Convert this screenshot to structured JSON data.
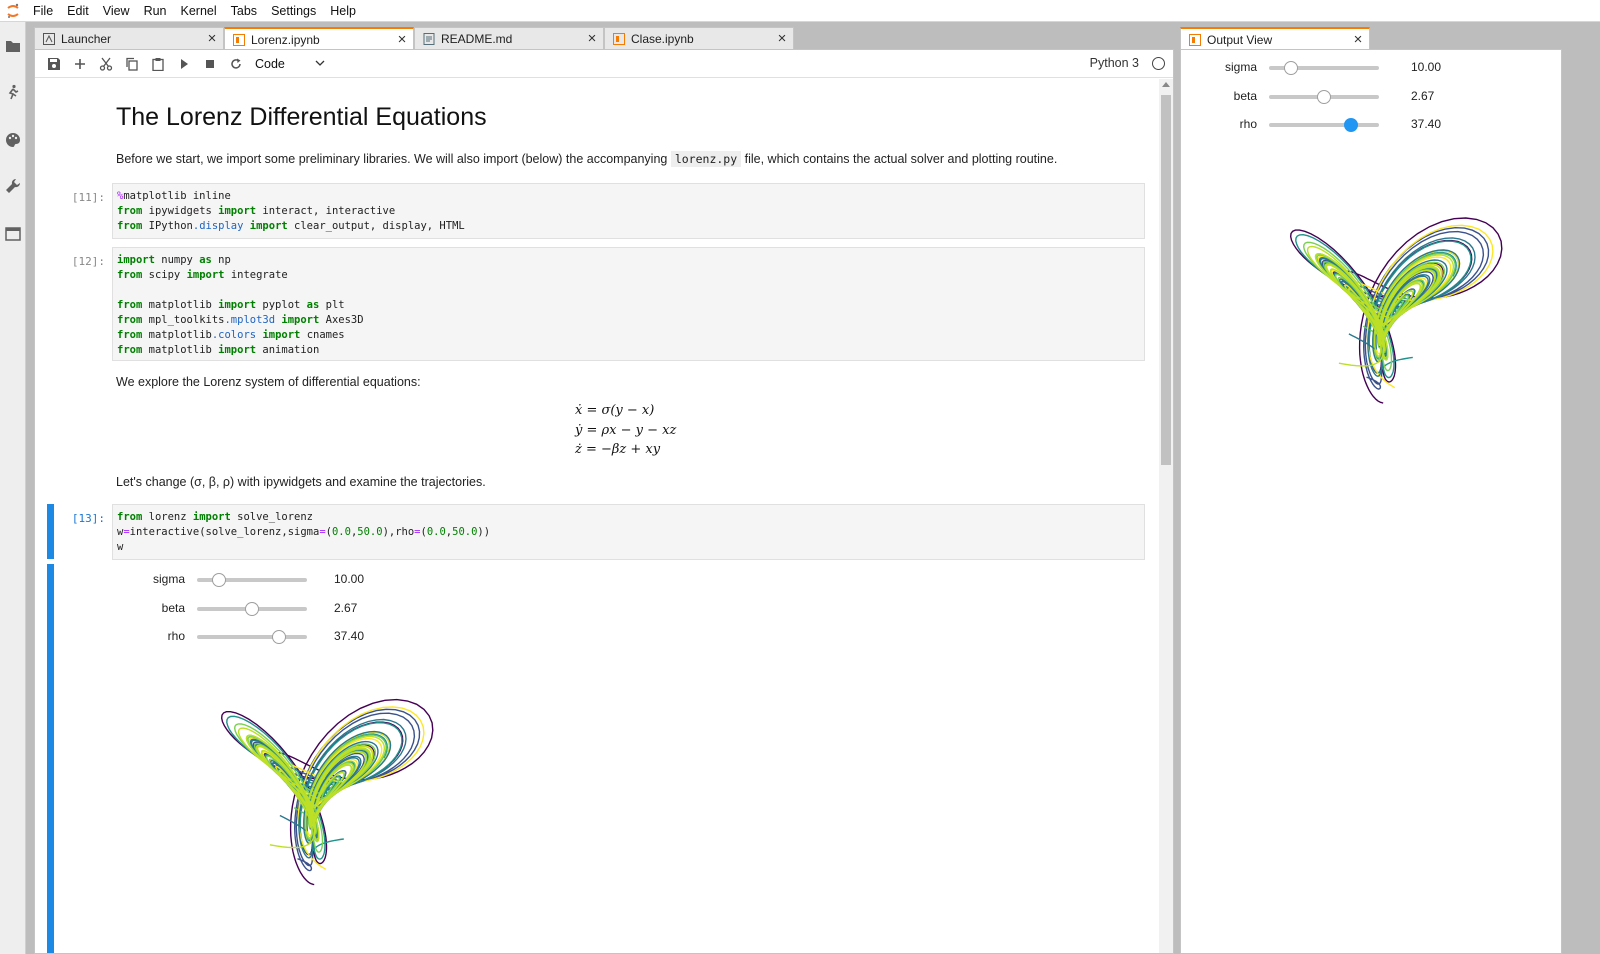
{
  "menu": [
    "File",
    "Edit",
    "View",
    "Run",
    "Kernel",
    "Tabs",
    "Settings",
    "Help"
  ],
  "tabs": [
    {
      "label": "Launcher",
      "icon": "launcher-icon"
    },
    {
      "label": "Lorenz.ipynb",
      "icon": "notebook-icon"
    },
    {
      "label": "README.md",
      "icon": "markdown-file-icon"
    },
    {
      "label": "Clase.ipynb",
      "icon": "notebook-icon"
    }
  ],
  "toolbar": {
    "cell_type": "Code",
    "kernel": "Python 3"
  },
  "notebook": {
    "title": "The Lorenz Differential Equations",
    "intro_before": "Before we start, we import some preliminary libraries. We will also import (below) the accompanying ",
    "intro_code": "lorenz.py",
    "intro_after": " file, which contains the actual solver and plotting routine.",
    "prompt11": "[11]:",
    "prompt12": "[12]:",
    "prompt13": "[13]:",
    "explore_text": "We explore the Lorenz system of differential equations:",
    "eq1": "ẋ = σ(y − x)",
    "eq2": "ẏ = ρx − y − xz",
    "eq3": "ż = −βz + xy",
    "change_text": "Let's change (σ, β, ρ) with ipywidgets and examine the trajectories.",
    "sliders": [
      {
        "label": "sigma",
        "value": "10.00",
        "fraction": 0.2
      },
      {
        "label": "beta",
        "value": "2.67",
        "fraction": 0.5
      },
      {
        "label": "rho",
        "value": "37.40",
        "fraction": 0.748
      }
    ]
  },
  "output_view": {
    "tab_label": "Output View",
    "sliders": [
      {
        "label": "sigma",
        "value": "10.00",
        "fraction": 0.2
      },
      {
        "label": "beta",
        "value": "2.67",
        "fraction": 0.5
      },
      {
        "label": "rho",
        "value": "37.40",
        "fraction": 0.748
      }
    ]
  },
  "colors": {
    "accent": "#f57c00",
    "active_cell": "#1e88e5",
    "palette": [
      "#440154",
      "#3b528b",
      "#21918c",
      "#5ec962",
      "#fde725",
      "#2a788e",
      "#7ad151",
      "#bddf26"
    ]
  }
}
